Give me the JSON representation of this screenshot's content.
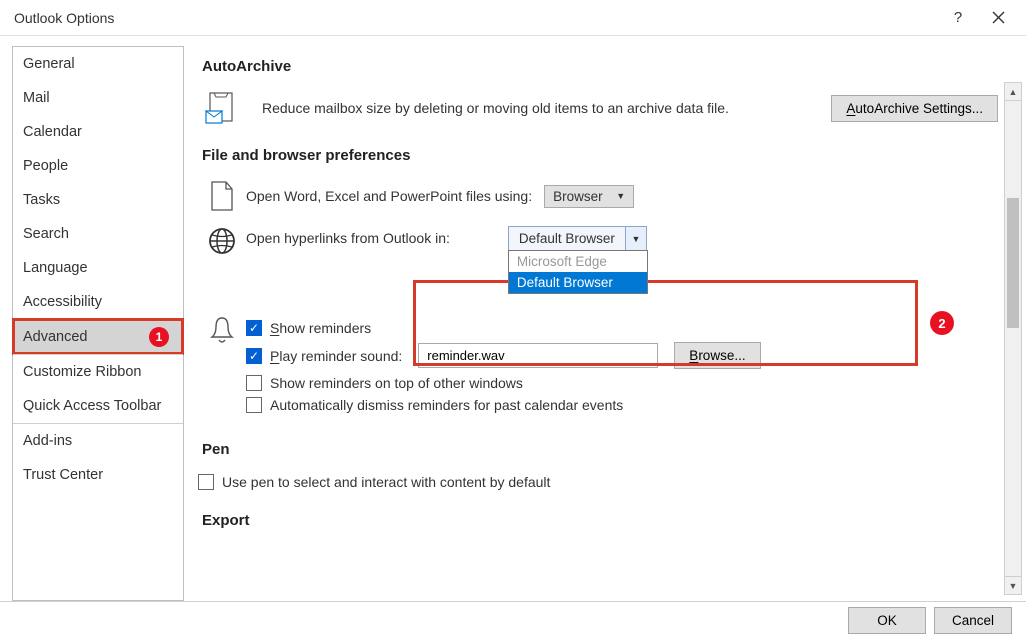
{
  "titlebar": {
    "title": "Outlook Options"
  },
  "sidebar": {
    "items": [
      {
        "label": "General"
      },
      {
        "label": "Mail"
      },
      {
        "label": "Calendar"
      },
      {
        "label": "People"
      },
      {
        "label": "Tasks"
      },
      {
        "label": "Search"
      },
      {
        "label": "Language"
      },
      {
        "label": "Accessibility"
      },
      {
        "label": "Advanced",
        "selected": true,
        "badge": "1"
      },
      {
        "label": "Customize Ribbon"
      },
      {
        "label": "Quick Access Toolbar"
      },
      {
        "label": "Add-ins"
      },
      {
        "label": "Trust Center"
      }
    ]
  },
  "sections": {
    "autoarchive": {
      "title": "AutoArchive",
      "text": "Reduce mailbox size by deleting or moving old items to an archive data file.",
      "button": "AutoArchive Settings..."
    },
    "filebrowser": {
      "title": "File and browser preferences",
      "open_files_label": "Open Word, Excel and PowerPoint files using:",
      "open_files_value": "Browser",
      "hyperlink_label": "Open hyperlinks from Outlook in:",
      "hyperlink_value": "Default Browser",
      "hyperlink_options": [
        "Microsoft Edge",
        "Default Browser"
      ],
      "badge": "2"
    },
    "reminders": {
      "show_reminders": "Show reminders",
      "play_sound": "Play reminder sound:",
      "sound_file": "reminder.wav",
      "browse": "Browse...",
      "on_top": "Show reminders on top of other windows",
      "auto_dismiss": "Automatically dismiss reminders for past calendar events"
    },
    "pen": {
      "title": "Pen",
      "use_pen": "Use pen to select and interact with content by default"
    },
    "export": {
      "title": "Export"
    }
  },
  "footer": {
    "ok": "OK",
    "cancel": "Cancel"
  }
}
